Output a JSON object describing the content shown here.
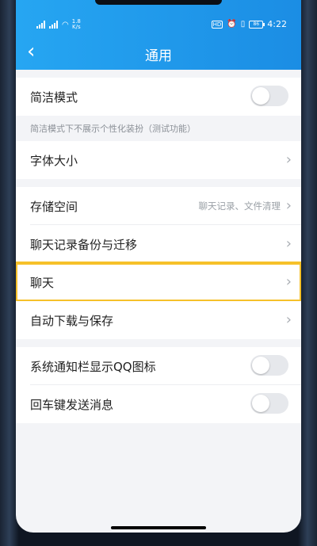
{
  "status": {
    "speed": "1.8\nK/s",
    "hd": "HD",
    "battery": "86",
    "time": "4:22"
  },
  "nav": {
    "back_icon": "‹",
    "title": "通用"
  },
  "settings": {
    "simple_mode": {
      "label": "简洁模式",
      "hint": "简洁模式下不展示个性化装扮（测试功能）"
    },
    "font_size": {
      "label": "字体大小"
    },
    "storage": {
      "label": "存储空间",
      "detail": "聊天记录、文件清理"
    },
    "backup": {
      "label": "聊天记录备份与迁移"
    },
    "chat": {
      "label": "聊天"
    },
    "auto_download": {
      "label": "自动下载与保存"
    },
    "notify_icon": {
      "label": "系统通知栏显示QQ图标"
    },
    "enter_send": {
      "label": "回车键发送消息"
    }
  },
  "icons": {
    "chevron": "›"
  },
  "colors": {
    "header_start": "#26a6f2",
    "header_end": "#1b8de4",
    "highlight": "#f6c12a"
  }
}
